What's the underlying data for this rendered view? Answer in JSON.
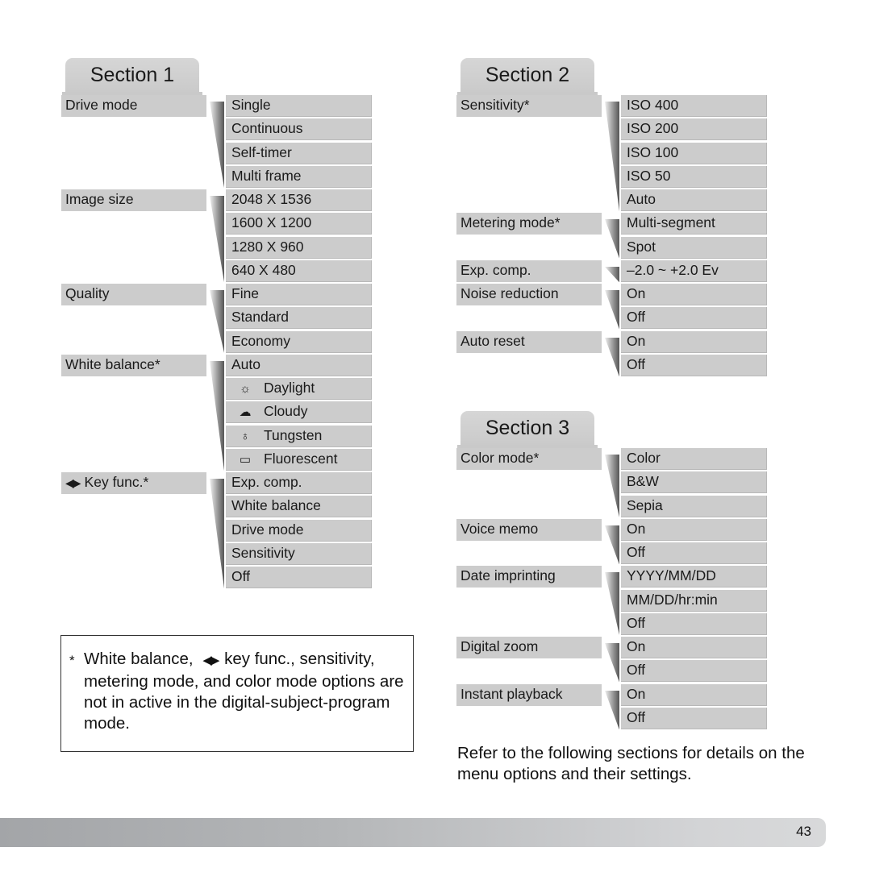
{
  "section1": {
    "title": "Section 1",
    "groups": [
      {
        "label": "Drive mode",
        "options": [
          {
            "text": "Single"
          },
          {
            "text": "Continuous"
          },
          {
            "text": "Self-timer"
          },
          {
            "text": "Multi frame"
          }
        ]
      },
      {
        "label": "Image size",
        "options": [
          {
            "text": "2048 X 1536"
          },
          {
            "text": "1600 X 1200"
          },
          {
            "text": "1280 X 960"
          },
          {
            "text": "640 X 480"
          }
        ]
      },
      {
        "label": "Quality",
        "options": [
          {
            "text": "Fine"
          },
          {
            "text": "Standard"
          },
          {
            "text": "Economy"
          }
        ]
      },
      {
        "label": "White balance*",
        "options": [
          {
            "text": "Auto"
          },
          {
            "text": "Daylight",
            "icon": "daylight-icon",
            "glyph": "☼"
          },
          {
            "text": "Cloudy",
            "icon": "cloudy-icon",
            "glyph": "☁"
          },
          {
            "text": "Tungsten",
            "icon": "tungsten-icon",
            "glyph": "♁"
          },
          {
            "text": "Fluorescent",
            "icon": "fluorescent-icon",
            "glyph": "▭"
          }
        ]
      },
      {
        "label": "Key func.*",
        "label_icon": "left-right-arrow-icon",
        "label_glyph": "◀▶",
        "options": [
          {
            "text": "Exp. comp."
          },
          {
            "text": "White balance"
          },
          {
            "text": "Drive mode"
          },
          {
            "text": "Sensitivity"
          },
          {
            "text": "Off"
          }
        ]
      }
    ]
  },
  "section2": {
    "title": "Section 2",
    "groups": [
      {
        "label": "Sensitivity*",
        "options": [
          {
            "text": "ISO 400"
          },
          {
            "text": "ISO 200"
          },
          {
            "text": "ISO 100"
          },
          {
            "text": "ISO 50"
          },
          {
            "text": "Auto"
          }
        ]
      },
      {
        "label": "Metering mode*",
        "options": [
          {
            "text": "Multi-segment"
          },
          {
            "text": "Spot"
          }
        ]
      },
      {
        "label": "Exp. comp.",
        "options": [
          {
            "text": "–2.0 ~ +2.0 Ev"
          }
        ]
      },
      {
        "label": "Noise reduction",
        "options": [
          {
            "text": "On"
          },
          {
            "text": "Off"
          }
        ]
      },
      {
        "label": "Auto reset",
        "options": [
          {
            "text": "On"
          },
          {
            "text": "Off"
          }
        ]
      }
    ]
  },
  "section3": {
    "title": "Section 3",
    "groups": [
      {
        "label": "Color mode*",
        "options": [
          {
            "text": "Color"
          },
          {
            "text": "B&W"
          },
          {
            "text": "Sepia"
          }
        ]
      },
      {
        "label": "Voice memo",
        "options": [
          {
            "text": "On"
          },
          {
            "text": "Off"
          }
        ]
      },
      {
        "label": "Date imprinting",
        "options": [
          {
            "text": "YYYY/MM/DD"
          },
          {
            "text": "MM/DD/hr:min"
          },
          {
            "text": "Off"
          }
        ]
      },
      {
        "label": "Digital zoom",
        "options": [
          {
            "text": "On"
          },
          {
            "text": "Off"
          }
        ]
      },
      {
        "label": "Instant playback",
        "options": [
          {
            "text": "On"
          },
          {
            "text": "Off"
          }
        ]
      }
    ]
  },
  "note": {
    "star": "*",
    "text_before_icon": "White balance,",
    "icon_glyph": "◀▶",
    "text_after_icon": "key func., sensitivity, metering mode, and color mode options are not in active in the digital-subject-program mode."
  },
  "refer_text": "Refer to the following sections for details on the menu options and their settings.",
  "page_number": "43"
}
